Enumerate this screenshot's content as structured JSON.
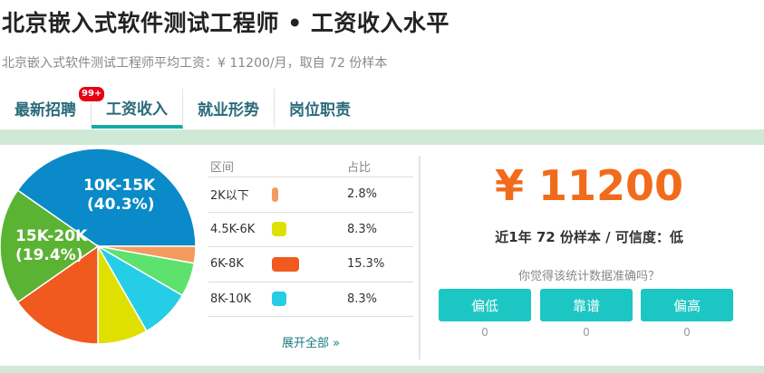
{
  "page": {
    "title": "北京嵌入式软件测试工程师 • 工资收入水平",
    "subtitle": "北京嵌入式软件测试工程师平均工资：¥ 11200/月，取自 72 份样本"
  },
  "tabs": [
    {
      "label": "最新招聘",
      "badge": "99+"
    },
    {
      "label": "工资收入"
    },
    {
      "label": "就业形势"
    },
    {
      "label": "岗位职责"
    }
  ],
  "distribution": {
    "header_range": "区间",
    "header_pct": "占比",
    "rows": [
      {
        "range": "2K以下",
        "percent": "2.8%",
        "value": 2.8,
        "color": "#f39b5f"
      },
      {
        "range": "4.5K-6K",
        "percent": "8.3%",
        "value": 8.3,
        "color": "#e0e000"
      },
      {
        "range": "6K-8K",
        "percent": "15.3%",
        "value": 15.3,
        "color": "#f05a1e"
      },
      {
        "range": "8K-10K",
        "percent": "8.3%",
        "value": 8.3,
        "color": "#25cde6"
      }
    ],
    "expand_label": "展开全部 »"
  },
  "chart_data": {
    "type": "pie",
    "slices": [
      {
        "label": "10K-15K",
        "value": 40.3,
        "color": "#0a8ac8",
        "text": "10K-15K",
        "pct_text": "(40.3%)"
      },
      {
        "label": "2K以下",
        "value": 2.8,
        "color": "#f39b5f"
      },
      {
        "label": "",
        "value": 5.6,
        "color": "#5ee26e"
      },
      {
        "label": "8K-10K",
        "value": 8.3,
        "color": "#25cde6"
      },
      {
        "label": "4.5K-6K",
        "value": 8.3,
        "color": "#e0e000"
      },
      {
        "label": "6K-8K",
        "value": 15.3,
        "color": "#f05a1e"
      },
      {
        "label": "15K-20K",
        "value": 19.4,
        "color": "#5bb334",
        "text": "15K-20K",
        "pct_text": "(19.4%)"
      }
    ]
  },
  "summary": {
    "amount": "¥ 11200",
    "meta": "近1年 72 份样本 / 可信度：低",
    "question": "你觉得该统计数据准确吗？",
    "votes": [
      {
        "label": "偏低",
        "count": "0"
      },
      {
        "label": "靠谱",
        "count": "0"
      },
      {
        "label": "偏高",
        "count": "0"
      }
    ]
  }
}
